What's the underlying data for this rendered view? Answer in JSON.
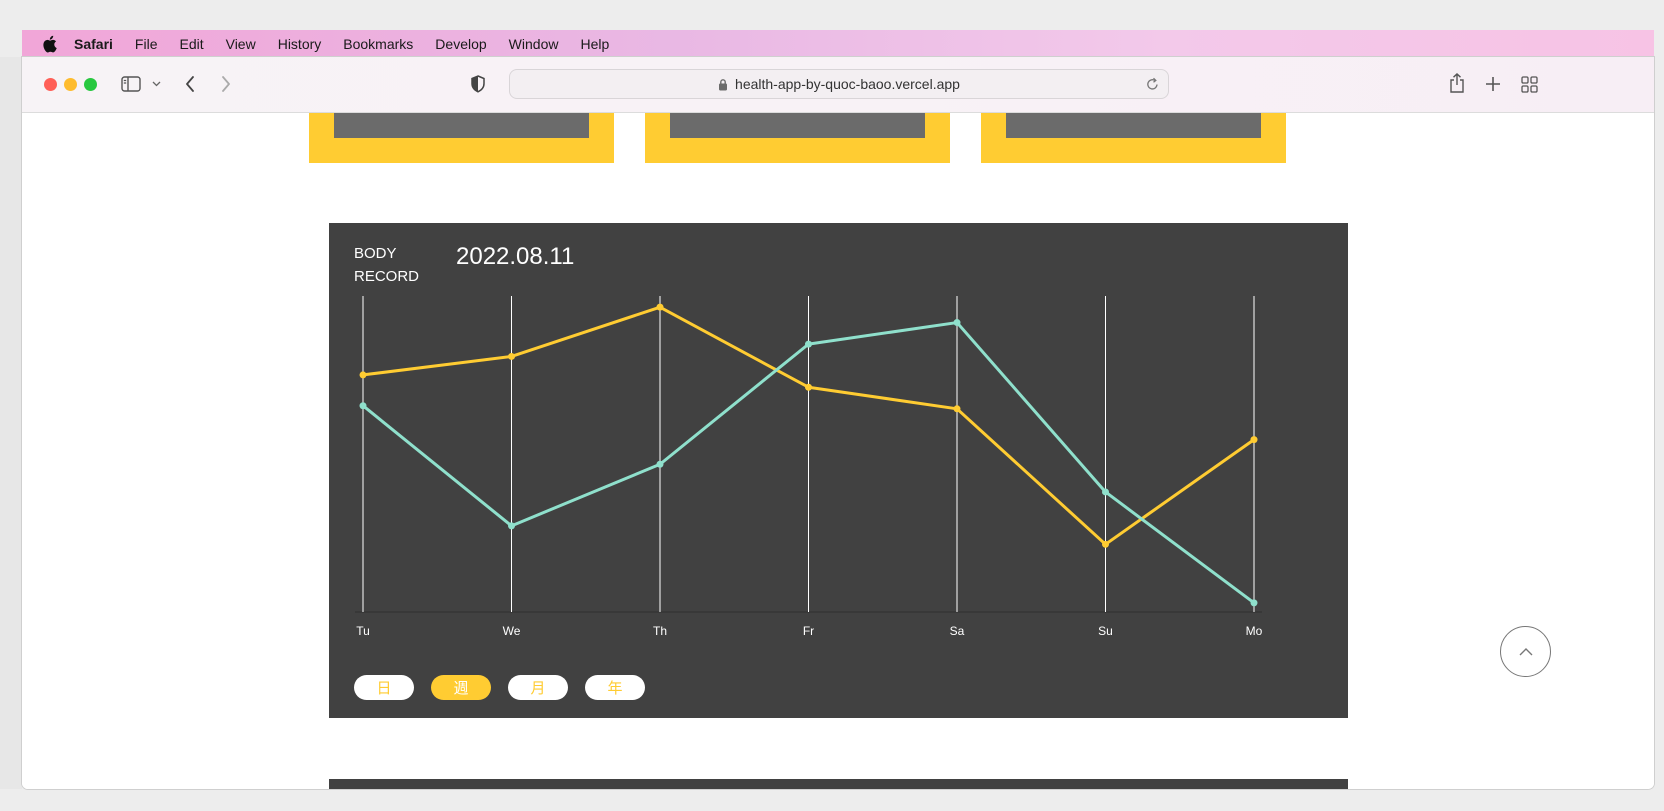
{
  "menubar": {
    "app_name": "Safari",
    "items": [
      "File",
      "Edit",
      "View",
      "History",
      "Bookmarks",
      "Develop",
      "Window",
      "Help"
    ]
  },
  "toolbar": {
    "url": "health-app-by-quoc-baoo.vercel.app"
  },
  "record": {
    "title_line1": "BODY",
    "title_line2": "RECORD",
    "date": "2022.08.11",
    "tabs": [
      {
        "label": "日",
        "active": false
      },
      {
        "label": "週",
        "active": true
      },
      {
        "label": "月",
        "active": false
      },
      {
        "label": "年",
        "active": false
      }
    ]
  },
  "chart_data": {
    "type": "line",
    "categories": [
      "Tu",
      "We",
      "Th",
      "Fr",
      "Sa",
      "Su",
      "Mo"
    ],
    "ylim": [
      0,
      100
    ],
    "grid": "vertical",
    "series": [
      {
        "color": "#ffcc32",
        "values": [
          76,
          82,
          98,
          72,
          65,
          21,
          55
        ]
      },
      {
        "color": "#8fe0cc",
        "values": [
          66,
          27,
          47,
          86,
          93,
          38,
          2
        ]
      }
    ]
  },
  "colors": {
    "accent": "#ffcc32",
    "panel": "#414141",
    "teal": "#8fe0cc"
  }
}
